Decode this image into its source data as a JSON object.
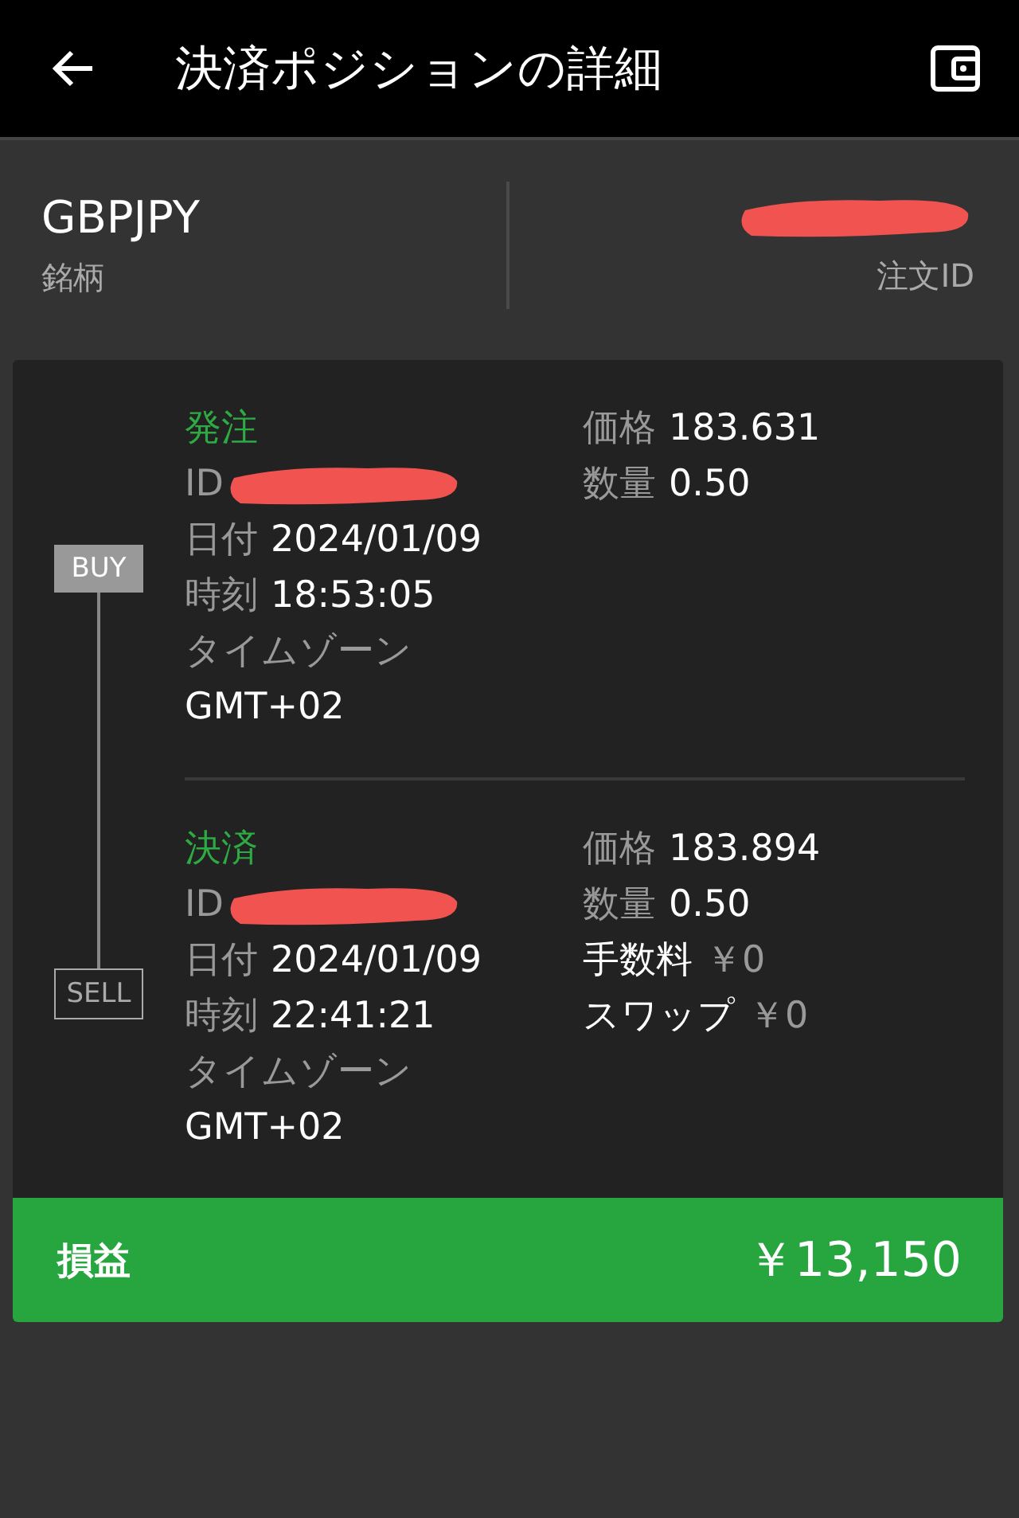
{
  "header": {
    "title": "決済ポジションの詳細"
  },
  "summary": {
    "symbol": "GBPJPY",
    "symbol_label": "銘柄",
    "order_id_label": "注文ID"
  },
  "sections": [
    {
      "title": "発注",
      "side": "BUY",
      "left": [
        {
          "kind": "redacted",
          "label": "ID"
        },
        {
          "kind": "inline",
          "label": "日付",
          "value": "2024/01/09"
        },
        {
          "kind": "inline",
          "label": "時刻",
          "value": "18:53:05"
        },
        {
          "kind": "stacked",
          "label": "タイムゾーン",
          "value": "GMT+02"
        }
      ],
      "right": [
        {
          "kind": "inline",
          "label": "価格",
          "value": "183.631"
        },
        {
          "kind": "inline",
          "label": "数量",
          "value": "0.50"
        }
      ]
    },
    {
      "title": "決済",
      "side": "SELL",
      "left": [
        {
          "kind": "redacted",
          "label": "ID"
        },
        {
          "kind": "inline",
          "label": "日付",
          "value": "2024/01/09"
        },
        {
          "kind": "inline",
          "label": "時刻",
          "value": "22:41:21"
        },
        {
          "kind": "stacked",
          "label": "タイムゾーン",
          "value": "GMT+02"
        }
      ],
      "right": [
        {
          "kind": "inline",
          "label": "価格",
          "value": "183.894"
        },
        {
          "kind": "inline",
          "label": "数量",
          "value": "0.50"
        },
        {
          "kind": "fee",
          "label": "手数料",
          "value": "￥0"
        },
        {
          "kind": "fee",
          "label": "スワップ",
          "value": "￥0"
        }
      ]
    }
  ],
  "profit": {
    "label": "損益",
    "value": "￥13,150"
  }
}
